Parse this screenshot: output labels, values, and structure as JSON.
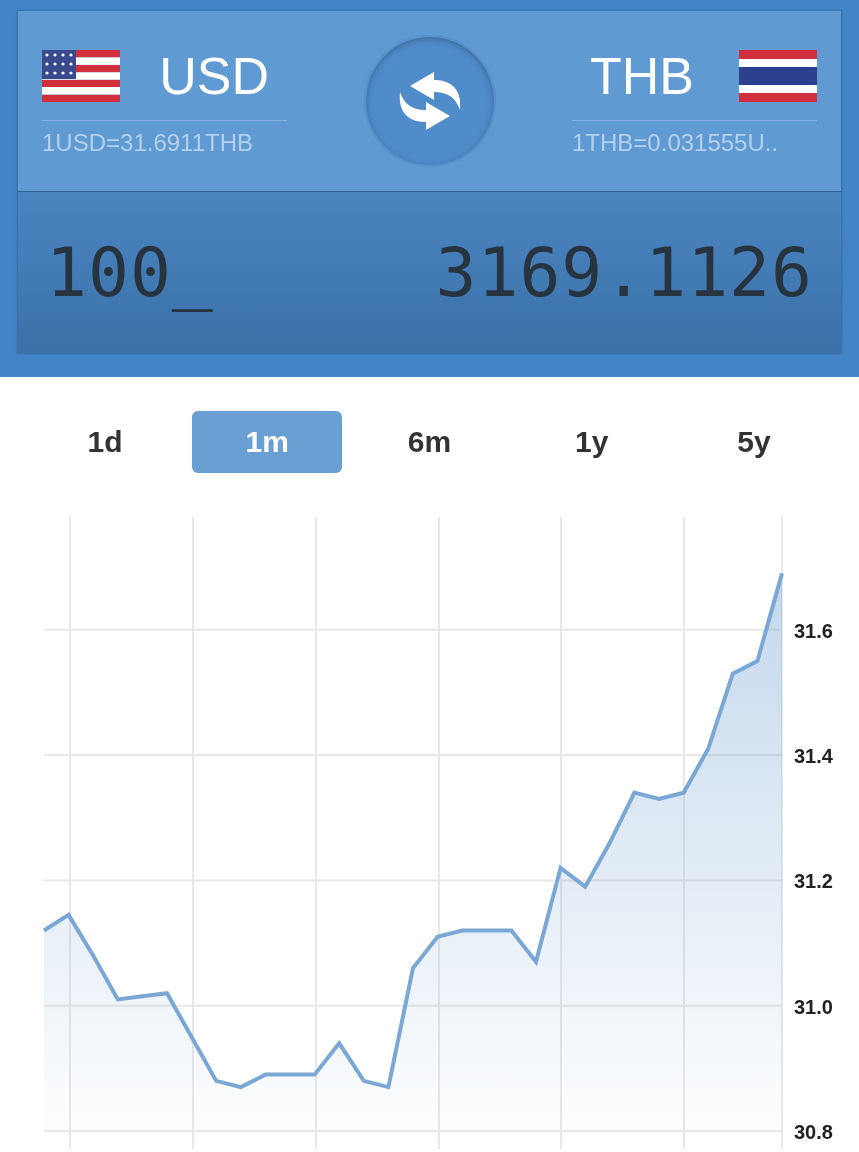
{
  "converter": {
    "from": {
      "code": "USD",
      "rate": "1USD=31.6911THB"
    },
    "to": {
      "code": "THB",
      "rate": "1THB=0.031555U.."
    },
    "input": "100_",
    "result": "3169.1126"
  },
  "tabs": [
    {
      "label": "1d",
      "selected": false
    },
    {
      "label": "1m",
      "selected": true
    },
    {
      "label": "6m",
      "selected": false
    },
    {
      "label": "1y",
      "selected": false
    },
    {
      "label": "5y",
      "selected": false
    }
  ],
  "chart": {
    "chart_data": {
      "type": "area",
      "categories": [
        null,
        null,
        null,
        null,
        null,
        null,
        null,
        null,
        null,
        null,
        null,
        null,
        null,
        null,
        null,
        null,
        null,
        null,
        null,
        null,
        null,
        null,
        null,
        null,
        null,
        null,
        null,
        null,
        null,
        null,
        null
      ],
      "ylim": [
        30.8,
        31.78
      ],
      "grid": true,
      "yticks": [
        {
          "value": 30.8,
          "label": "30.8"
        },
        {
          "value": 31.0,
          "label": "31.0"
        },
        {
          "value": 31.2,
          "label": "31.2"
        },
        {
          "value": 31.4,
          "label": "31.4"
        },
        {
          "value": 31.6,
          "label": "31.6"
        }
      ],
      "series": [
        {
          "color": "#7ba7d4",
          "values": [
            31.12,
            31.145,
            31.08,
            31.01,
            31.015,
            31.02,
            30.95,
            30.88,
            30.87,
            30.89,
            30.89,
            30.89,
            30.94,
            30.88,
            30.87,
            31.06,
            31.11,
            31.12,
            31.12,
            31.12,
            31.07,
            31.22,
            31.19,
            31.26,
            31.34,
            31.33,
            31.34,
            31.41,
            31.53,
            31.55,
            31.69
          ]
        }
      ]
    }
  }
}
